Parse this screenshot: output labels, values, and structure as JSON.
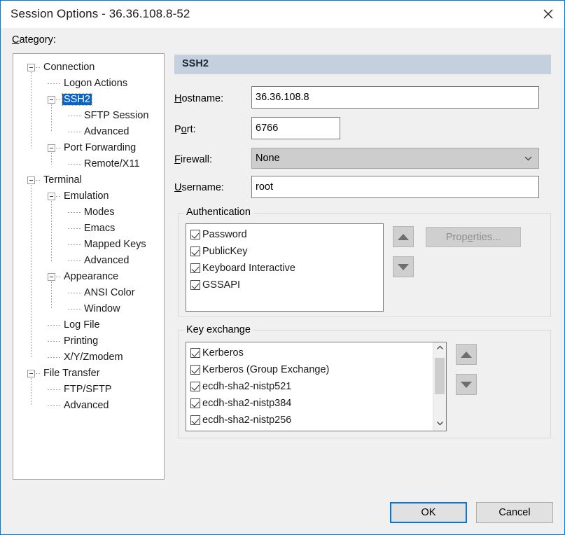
{
  "window": {
    "title": "Session Options - 36.36.108.8-52",
    "close_icon": "close-icon",
    "accent_color": "#0078d7",
    "background": "#f0f0f0"
  },
  "category": {
    "label_pre": "C",
    "label_accel": "",
    "label": "Category:"
  },
  "tree": {
    "selected": "SSH2",
    "nodes": [
      {
        "label": "Connection",
        "level": 0,
        "expander": "collapse",
        "selected": false
      },
      {
        "label": "Logon Actions",
        "level": 1,
        "expander": "none",
        "selected": false
      },
      {
        "label": "SSH2",
        "level": 1,
        "expander": "collapse",
        "selected": true
      },
      {
        "label": "SFTP Session",
        "level": 2,
        "expander": "none",
        "selected": false
      },
      {
        "label": "Advanced",
        "level": 2,
        "expander": "none",
        "selected": false
      },
      {
        "label": "Port Forwarding",
        "level": 1,
        "expander": "collapse",
        "selected": false
      },
      {
        "label": "Remote/X11",
        "level": 2,
        "expander": "none",
        "selected": false
      },
      {
        "label": "Terminal",
        "level": 0,
        "expander": "collapse",
        "selected": false
      },
      {
        "label": "Emulation",
        "level": 1,
        "expander": "collapse",
        "selected": false
      },
      {
        "label": "Modes",
        "level": 2,
        "expander": "none",
        "selected": false
      },
      {
        "label": "Emacs",
        "level": 2,
        "expander": "none",
        "selected": false
      },
      {
        "label": "Mapped Keys",
        "level": 2,
        "expander": "none",
        "selected": false
      },
      {
        "label": "Advanced",
        "level": 2,
        "expander": "none",
        "selected": false
      },
      {
        "label": "Appearance",
        "level": 1,
        "expander": "collapse",
        "selected": false
      },
      {
        "label": "ANSI Color",
        "level": 2,
        "expander": "none",
        "selected": false
      },
      {
        "label": "Window",
        "level": 2,
        "expander": "none",
        "selected": false
      },
      {
        "label": "Log File",
        "level": 1,
        "expander": "none",
        "selected": false
      },
      {
        "label": "Printing",
        "level": 1,
        "expander": "none",
        "selected": false
      },
      {
        "label": "X/Y/Zmodem",
        "level": 1,
        "expander": "none",
        "selected": false
      },
      {
        "label": "File Transfer",
        "level": 0,
        "expander": "collapse",
        "selected": false
      },
      {
        "label": "FTP/SFTP",
        "level": 1,
        "expander": "none",
        "selected": false
      },
      {
        "label": "Advanced",
        "level": 1,
        "expander": "none",
        "selected": false
      }
    ]
  },
  "pane": {
    "header": "SSH2",
    "header_color": "#c5d0de",
    "fields": {
      "hostname": {
        "label_a": "H",
        "label_b": "ostname:",
        "value": "36.36.108.8"
      },
      "port": {
        "label_a": "P",
        "label_accel": "o",
        "label_b": "rt:",
        "value": "6766"
      },
      "firewall": {
        "label_a": "F",
        "label_b": "irewall:",
        "value": "None",
        "icon": "chevron-down-icon"
      },
      "username": {
        "label_a": "U",
        "label_b": "sername:",
        "value": "root"
      }
    },
    "authentication": {
      "legend": "Authentication",
      "items": [
        {
          "label": "Password",
          "checked": true
        },
        {
          "label": "PublicKey",
          "checked": true
        },
        {
          "label": "Keyboard Interactive",
          "checked": true
        },
        {
          "label": "GSSAPI",
          "checked": true
        }
      ],
      "move_up_icon": "arrow-up-icon",
      "move_down_icon": "arrow-down-icon",
      "properties_button": {
        "label_a": "Prop",
        "label_accel": "e",
        "label_b": "rties...",
        "disabled": true
      }
    },
    "key_exchange": {
      "legend": "Key exchange",
      "items": [
        {
          "label": "Kerberos",
          "checked": true
        },
        {
          "label": "Kerberos (Group Exchange)",
          "checked": true
        },
        {
          "label": "ecdh-sha2-nistp521",
          "checked": true
        },
        {
          "label": "ecdh-sha2-nistp384",
          "checked": true
        },
        {
          "label": "ecdh-sha2-nistp256",
          "checked": true
        }
      ],
      "scroll_up_icon": "chevron-up-icon",
      "scroll_down_icon": "chevron-down-icon",
      "move_up_icon": "arrow-up-icon",
      "move_down_icon": "arrow-down-icon"
    }
  },
  "footer": {
    "ok": "OK",
    "cancel": "Cancel"
  }
}
